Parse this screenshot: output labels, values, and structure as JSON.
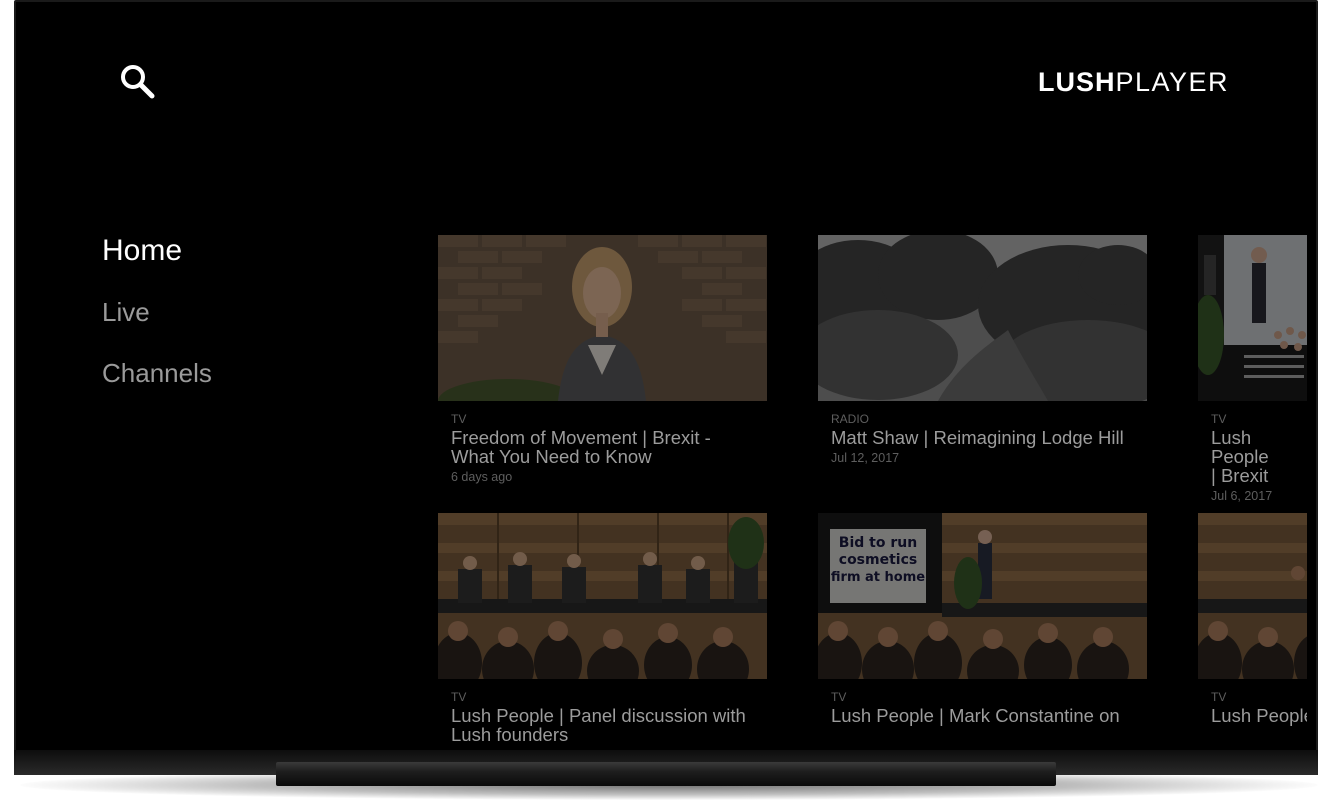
{
  "app": {
    "logo_bold": "LUSH",
    "logo_light": "PLAYER"
  },
  "header": {
    "search_icon": "search-icon"
  },
  "nav": {
    "items": [
      {
        "label": "Home",
        "active": true
      },
      {
        "label": "Live",
        "active": false
      },
      {
        "label": "Channels",
        "active": false
      }
    ]
  },
  "cards": [
    {
      "category": "TV",
      "title": "Freedom of Movement | Brexit - What You Need to Know",
      "date": "6 days ago"
    },
    {
      "category": "RADIO",
      "title": "Matt Shaw | Reimagining Lodge Hill",
      "date": "Jul 12, 2017"
    },
    {
      "category": "TV",
      "title": "Lush People | Brexit",
      "date": "Jul 6, 2017"
    },
    {
      "category": "TV",
      "title": "Lush People | Panel discussion with Lush founders",
      "date": ""
    },
    {
      "category": "TV",
      "title": "Lush People | Mark Constantine on",
      "date": ""
    },
    {
      "category": "TV",
      "title": "Lush People | Lush",
      "date": ""
    }
  ],
  "banner_text": {
    "line1": "Bid to run",
    "line2": "cosmetics",
    "line3": "firm at home"
  },
  "colors": {
    "screen_bg": "#000000",
    "nav_active": "#ffffff",
    "nav_inactive": "#9a9a9a",
    "card_title": "#9c9c9c",
    "card_meta": "#5e5e5e"
  }
}
